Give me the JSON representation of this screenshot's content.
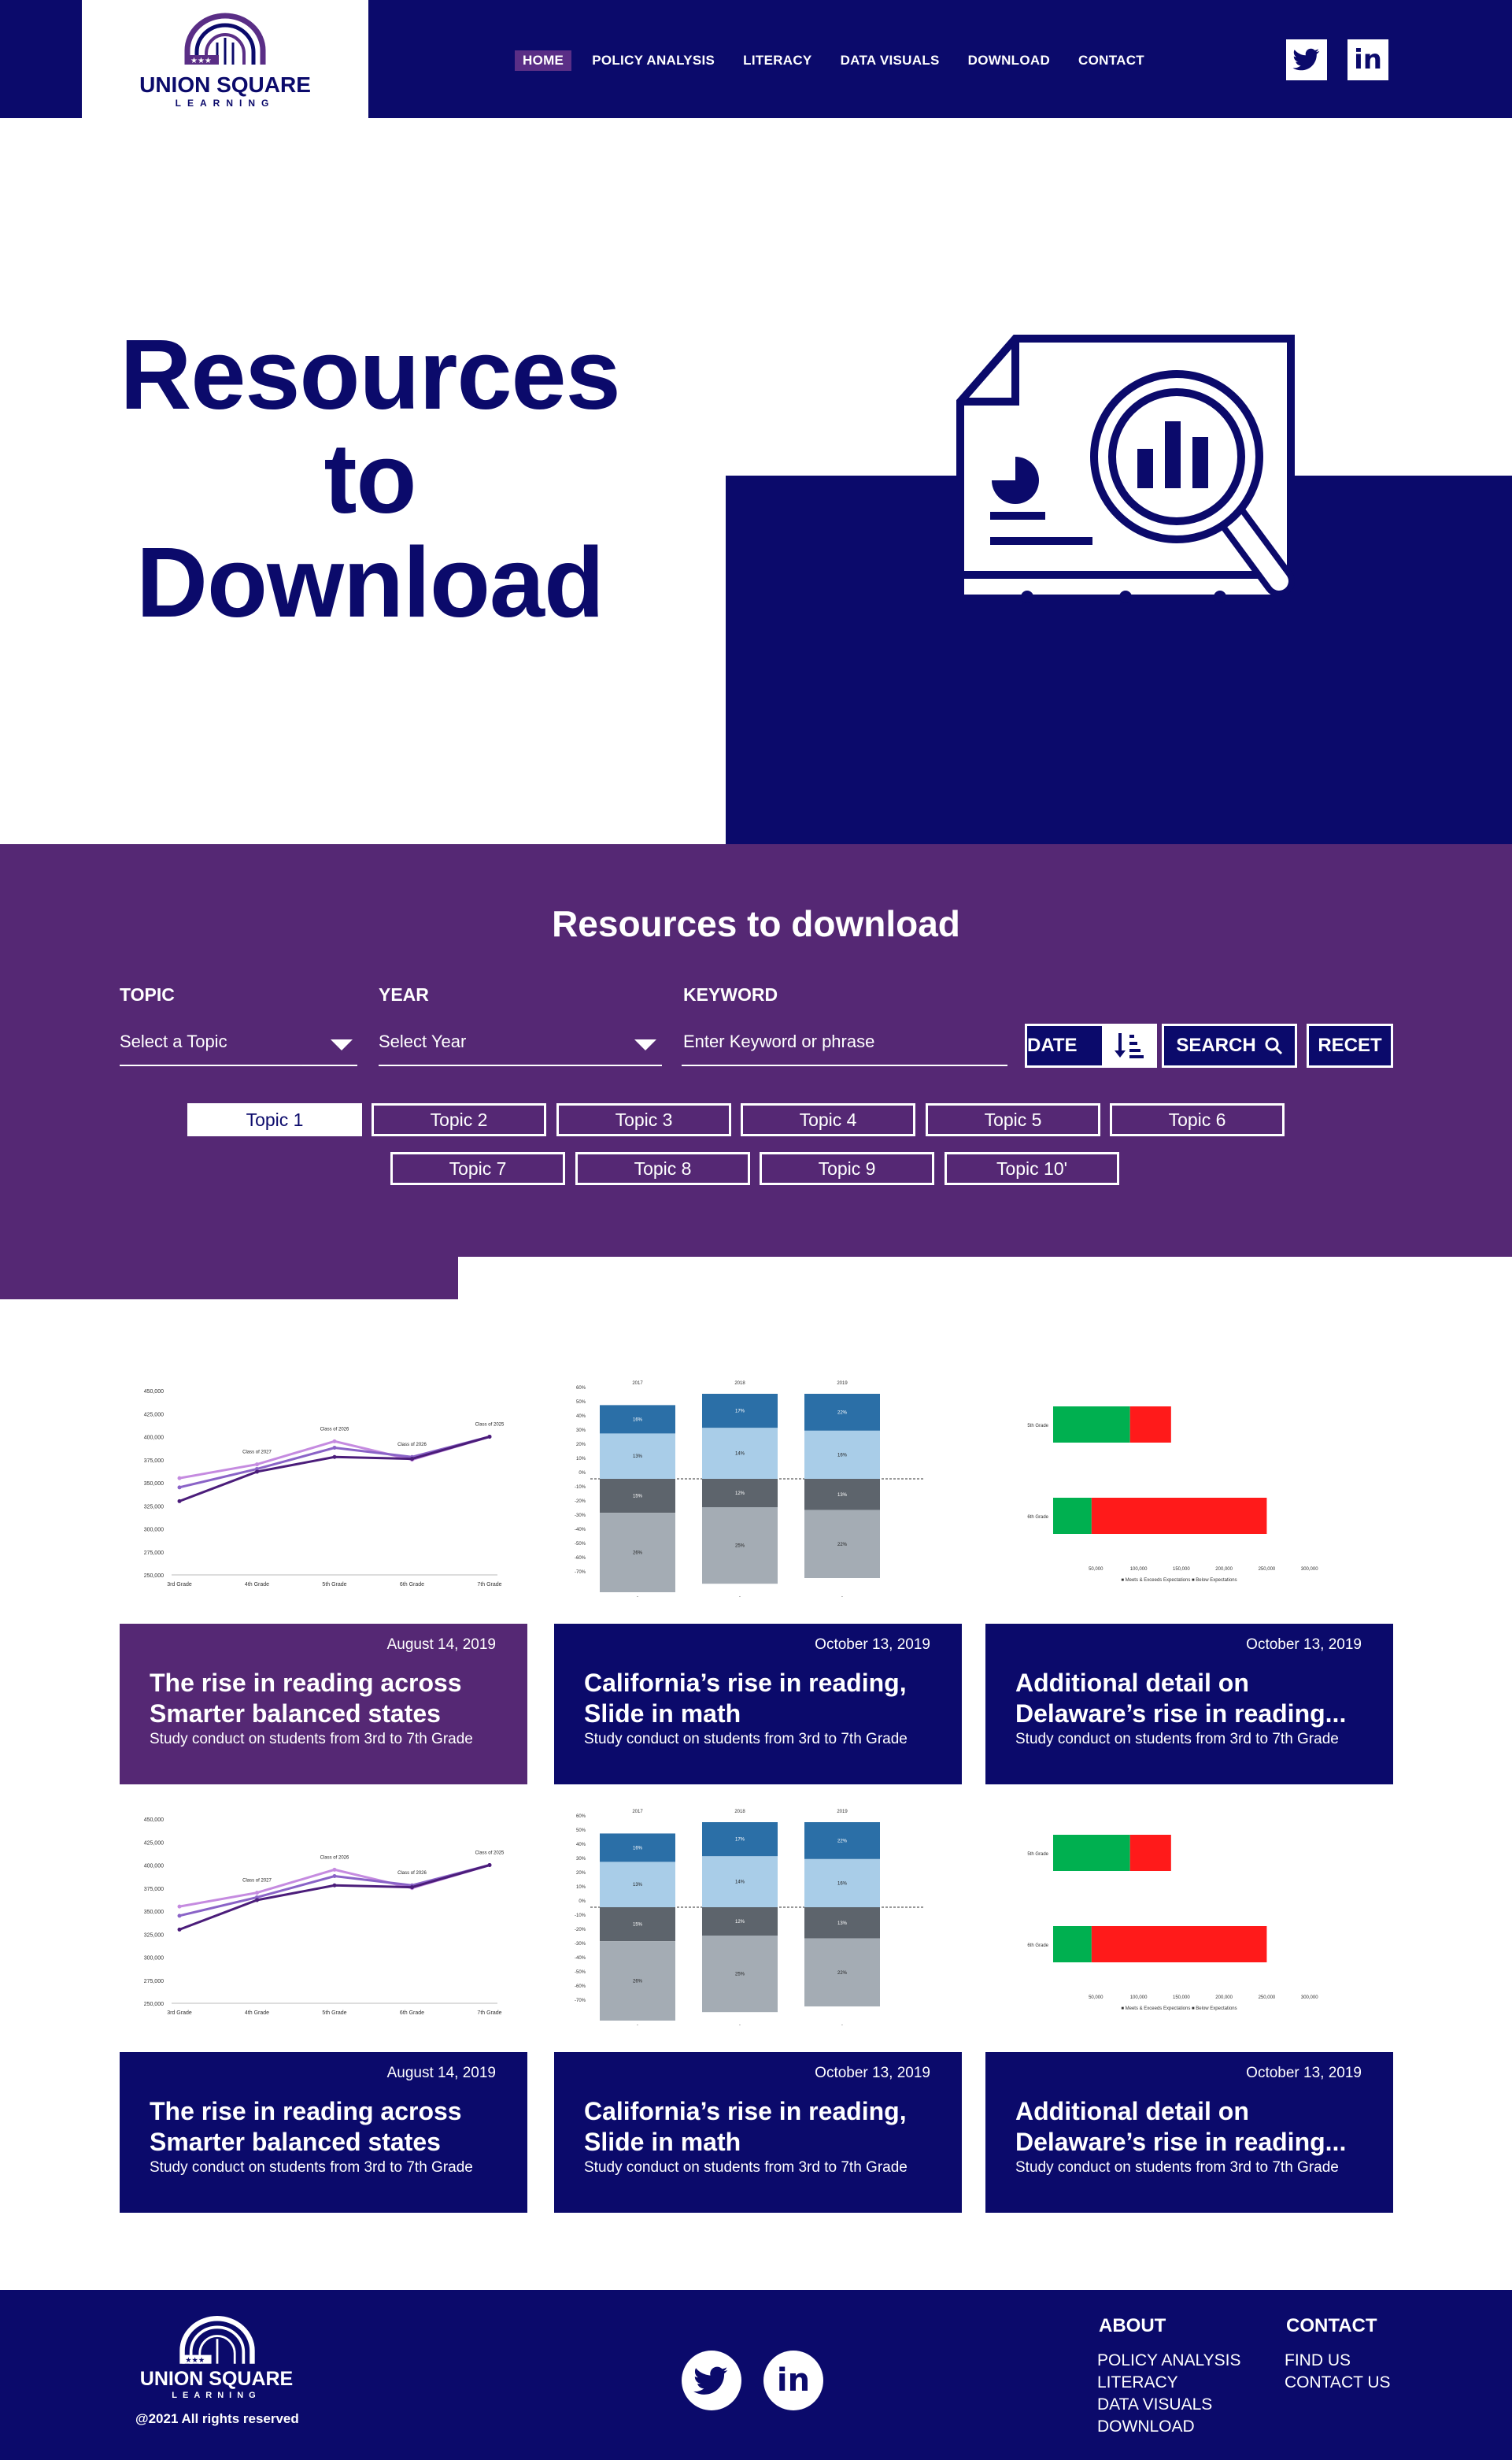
{
  "brand": {
    "name": "UNION SQUARE",
    "tagline": "LEARNING"
  },
  "nav": {
    "items": [
      "HOME",
      "POLICY ANALYSIS",
      "LITERACY",
      "DATA VISUALS",
      "DOWNLOAD",
      "CONTACT"
    ],
    "active": "HOME"
  },
  "social": {
    "twitter": "twitter-icon",
    "linkedin": "linkedin-icon",
    "linkedin_text": "in"
  },
  "hero": {
    "title_line1": "Resources",
    "title_line2": "to",
    "title_line3": "Download"
  },
  "filters": {
    "section_title": "Resources to download",
    "topic_label": "TOPIC",
    "topic_value": "Select a Topic",
    "year_label": "YEAR",
    "year_value": "Select Year",
    "keyword_label": "KEYWORD",
    "keyword_placeholder": "Enter Keyword or phrase",
    "date_label": "DATE",
    "search_label": "SEARCH",
    "reset_label": "RECET",
    "topics": [
      "Topic 1",
      "Topic 2",
      "Topic 3",
      "Topic 4",
      "Topic 5",
      "Topic 6",
      "Topic 7",
      "Topic 8",
      "Topic 9",
      "Topic 10'"
    ],
    "selected_topic": "Topic 1"
  },
  "cards": [
    {
      "date": "August 14, 2019",
      "title": "The rise in reading across\nSmarter balanced states",
      "subtitle": "Study conduct on students from 3rd to 7th Grade",
      "chart": "line"
    },
    {
      "date": "October 13, 2019",
      "title": "California’s rise in reading,\nSlide in math",
      "subtitle": "Study conduct on students from 3rd to 7th Grade",
      "chart": "stacked"
    },
    {
      "date": "October 13, 2019",
      "title": "Additional detail on\nDelaware’s rise in reading...",
      "subtitle": "Study conduct on students from 3rd to 7th Grade",
      "chart": "hbar"
    },
    {
      "date": "August 14, 2019",
      "title": "The rise in reading across\nSmarter balanced states",
      "subtitle": "Study conduct on students from 3rd to 7th Grade",
      "chart": "line"
    },
    {
      "date": "October 13, 2019",
      "title": "California’s rise in reading,\nSlide in math",
      "subtitle": "Study conduct on students from 3rd to 7th Grade",
      "chart": "stacked"
    },
    {
      "date": "October 13, 2019",
      "title": "Additional detail on\nDelaware’s rise in reading...",
      "subtitle": "Study conduct on students from 3rd to 7th Grade",
      "chart": "hbar"
    }
  ],
  "thumb_charts": {
    "line": {
      "categories": [
        "3rd Grade",
        "4th Grade",
        "5th Grade",
        "6th Grade",
        "7th Grade"
      ],
      "series": [
        {
          "values": [
            355000,
            370000,
            395000,
            375000,
            400000
          ],
          "color": "#c58be0"
        },
        {
          "values": [
            345000,
            365000,
            388000,
            378000,
            400000
          ],
          "color": "#8a63c7"
        },
        {
          "values": [
            330000,
            362000,
            378000,
            376000,
            400000
          ],
          "color": "#4b1d7a"
        }
      ],
      "annotations": [
        {
          "text": "Class of 2027",
          "cat": 1
        },
        {
          "text": "Class of 2026",
          "cat": 2
        },
        {
          "text": "Class of 2026",
          "cat": 3
        },
        {
          "text": "Class of 2025",
          "cat": 4
        }
      ],
      "yticks": [
        "450,000",
        "425,000",
        "400,000",
        "375,000",
        "350,000",
        "325,000",
        "300,000",
        "275,000",
        "250,000"
      ]
    },
    "stacked": {
      "groups": [
        "2017",
        "2018",
        "2019"
      ],
      "pos": [
        [
          16,
          10
        ],
        [
          18,
          12
        ],
        [
          17,
          13
        ]
      ],
      "neg": [
        [
          12,
          28
        ],
        [
          10,
          27
        ],
        [
          11,
          24
        ]
      ],
      "pos_labels": [
        [
          "13%",
          "16%"
        ],
        [
          "14%",
          "17%"
        ],
        [
          "16%",
          "22%"
        ]
      ],
      "neg_labels": [
        [
          "15%",
          "26%"
        ],
        [
          "12%",
          "25%"
        ],
        [
          "13%",
          "22%"
        ]
      ],
      "pos_colors": [
        "#a9cde8",
        "#2b6fa7"
      ],
      "neg_colors": [
        "#5d646c",
        "#a4acb4"
      ]
    },
    "hbar": {
      "rows": [
        "5th Grade",
        "6th Grade"
      ],
      "green": [
        90000,
        45000
      ],
      "red": [
        48000,
        205000
      ],
      "axis": [
        "50,000",
        "100,000",
        "150,000",
        "200,000",
        "250,000",
        "300,000"
      ],
      "legend": [
        "Meets & Exceeds Expectations",
        "Below Expectations"
      ]
    }
  },
  "footer": {
    "about_heading": "ABOUT",
    "about_links": [
      "POLICY ANALYSIS",
      "LITERACY",
      "DATA VISUALS",
      "DOWNLOAD"
    ],
    "contact_heading": "CONTACT",
    "contact_links": [
      "FIND US",
      "CONTACT US"
    ],
    "copyright": "@2021 All rights reserved"
  },
  "colors": {
    "navy": "#0b0a6b",
    "purple": "#552874",
    "active_nav": "#5a2e86",
    "white": "#ffffff"
  }
}
